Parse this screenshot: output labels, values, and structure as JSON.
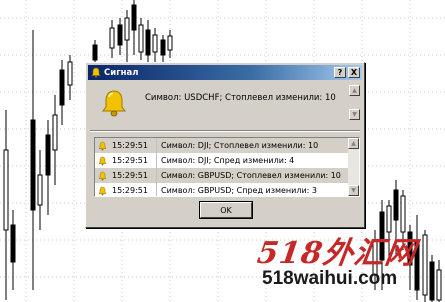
{
  "dialog": {
    "title": "Сигнал",
    "help_label": "?",
    "close_label": "X",
    "main_message": "Символ: USDCHF; Стоплевел изменили: 10",
    "ok_label": "OK"
  },
  "alerts": [
    {
      "time": "15:29:51",
      "message": "Символ: DJI; Стоплевел изменили: 10",
      "selected": true
    },
    {
      "time": "15:29:51",
      "message": "Символ: DJI; Спред изменили: 4",
      "selected": false
    },
    {
      "time": "15:29:51",
      "message": "Символ: GBPUSD; Стоплевел изменили: 10",
      "selected": true
    },
    {
      "time": "15:29:51",
      "message": "Символ: GBPUSD; Спред изменили: 3",
      "selected": false
    }
  ],
  "watermark": {
    "line1": "518外汇网",
    "line2": "518waihui.com"
  },
  "colors": {
    "titlebar_start": "#0a246a",
    "titlebar_end": "#a6caf0",
    "dialog_face": "#d4d0c8",
    "bell": "#f2c200",
    "watermark_red": "#c62828"
  },
  "icons": {
    "title": "bell-icon",
    "message": "bell-icon"
  }
}
